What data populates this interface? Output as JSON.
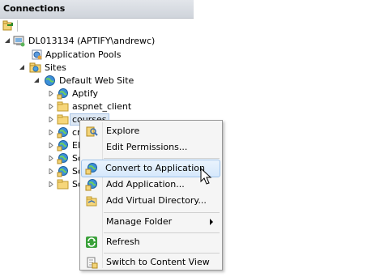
{
  "panel": {
    "title": "Connections"
  },
  "tree": {
    "server": "DL013134 (APTIFY\\andrewc)",
    "app_pools": "Application Pools",
    "sites": "Sites",
    "default_site": "Default Web Site",
    "children": [
      {
        "label": "Aptify",
        "icon": "web-app-icon"
      },
      {
        "label": "aspnet_client",
        "icon": "folder-icon"
      },
      {
        "label": "courses",
        "icon": "folder-icon",
        "selected": true
      },
      {
        "label": "cr",
        "icon": "web-app-icon"
      },
      {
        "label": "Eb",
        "icon": "web-app-icon"
      },
      {
        "label": "So",
        "icon": "web-app-icon"
      },
      {
        "label": "So",
        "icon": "web-app-icon"
      },
      {
        "label": "So",
        "icon": "folder-icon"
      }
    ]
  },
  "context_menu": {
    "explore": "Explore",
    "edit_permissions": "Edit Permissions...",
    "convert_to_application": "Convert to Application",
    "add_application": "Add Application...",
    "add_virtual_directory": "Add Virtual Directory...",
    "manage_folder": "Manage Folder",
    "refresh": "Refresh",
    "switch_to_content_view": "Switch to Content View"
  }
}
